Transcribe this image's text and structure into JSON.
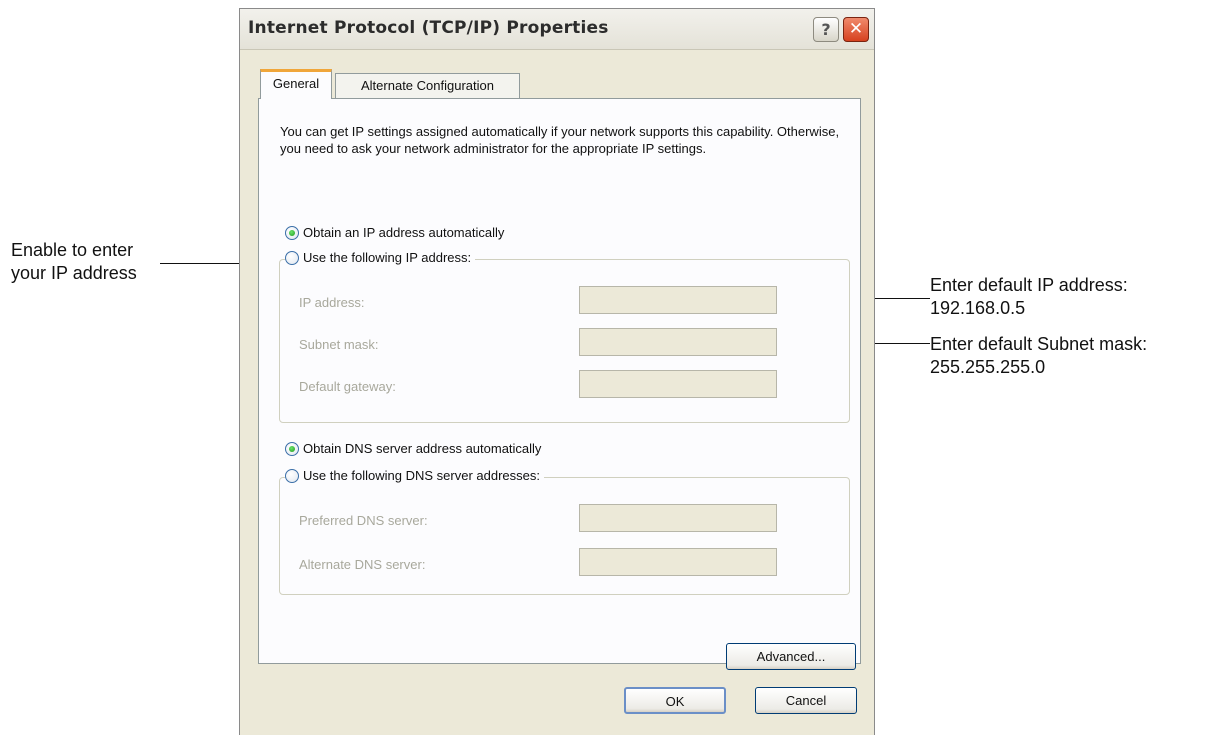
{
  "dialog": {
    "title": "Internet Protocol (TCP/IP) Properties",
    "help_glyph": "?",
    "close_glyph": "✕",
    "tabs": [
      {
        "label": "General",
        "active": true
      },
      {
        "label": "Alternate Configuration",
        "active": false
      }
    ],
    "description": "You can get IP settings assigned automatically if your network supports this capability. Otherwise, you need to ask your network administrator for the appropriate IP settings.",
    "ip_options": {
      "auto_label": "Obtain an IP address automatically",
      "auto_checked": true,
      "manual_label": "Use the following IP address:",
      "manual_checked": false
    },
    "ip_fields": [
      {
        "label": "IP address:",
        "value": ""
      },
      {
        "label": "Subnet mask:",
        "value": ""
      },
      {
        "label": "Default gateway:",
        "value": ""
      }
    ],
    "dns_options": {
      "auto_label": "Obtain DNS server address automatically",
      "auto_checked": true,
      "manual_label": "Use the following DNS server addresses:",
      "manual_checked": false
    },
    "dns_fields": [
      {
        "label": "Preferred DNS server:",
        "value": ""
      },
      {
        "label": "Alternate DNS server:",
        "value": ""
      }
    ],
    "advanced_label": "Advanced...",
    "ok_label": "OK",
    "cancel_label": "Cancel"
  },
  "callouts": {
    "enable_ip": {
      "line1": "Enable to enter",
      "line2": "your IP address"
    },
    "ip_default": {
      "line1": "Enter default IP address:",
      "line2": "192.168.0.5"
    },
    "subnet_default": {
      "line1": "Enter default Subnet mask:",
      "line2": "255.255.255.0"
    }
  },
  "colors": {
    "window_bg": "#ece9d8",
    "panel_bg": "#fcfcfe",
    "close_button": "#d6411f",
    "active_tab_accent": "#f0a63a",
    "radio_selected": "#1f9a1f",
    "disabled_text": "#a8a89c"
  }
}
